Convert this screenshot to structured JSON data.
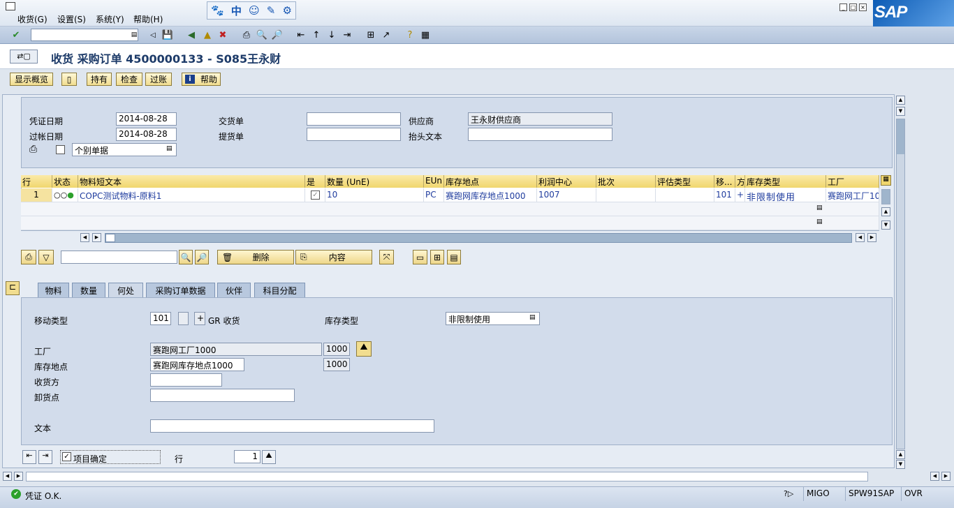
{
  "menu": [
    "收货(G)",
    "设置(S)",
    "系统(Y)",
    "帮助(H)"
  ],
  "sys_icons": [
    "paw-icon",
    "中",
    "smile-icon",
    "pen-icon",
    "gear-icon"
  ],
  "sap_logo": "SAP",
  "title": "收货 采购订单 4500000133 - S085王永财",
  "app_buttons": [
    "显示概览",
    "持有",
    "检查",
    "过账",
    "帮助"
  ],
  "header": {
    "doc_date_label": "凭证日期",
    "doc_date": "2014-08-28",
    "post_date_label": "过帐日期",
    "post_date": "2014-08-28",
    "slip_option": "个别单据",
    "delivery_note_label": "交货单",
    "delivery_note": "",
    "bill_of_lading_label": "提货单",
    "bill_of_lading": "",
    "vendor_label": "供应商",
    "vendor": "王永财供应商",
    "header_text_label": "抬头文本",
    "header_text": ""
  },
  "grid": {
    "columns": [
      "行",
      "状态",
      "物料短文本",
      "是",
      "数量 (UnE)",
      "EUn",
      "库存地点",
      "利润中心",
      "批次",
      "评估类型",
      "移...",
      "方",
      "库存类型",
      "工厂"
    ],
    "rows": [
      {
        "line": "1",
        "status": "COO",
        "material": "COPC测试物料-原料1",
        "ok": true,
        "qty": "10",
        "unit": "PC",
        "sloc": "赛跑网库存地点1000",
        "profit_center": "1007",
        "batch": "",
        "valuation": "",
        "mvt": "101",
        "dir": "+",
        "stock_type": "非限制使用",
        "plant": "赛跑网工厂10"
      }
    ]
  },
  "item_buttons": {
    "delete": "删除",
    "contents": "内容"
  },
  "tabs": [
    "物料",
    "数量",
    "何处",
    "采购订单数据",
    "伙伴",
    "科目分配"
  ],
  "active_tab": 2,
  "where": {
    "mvt_type_label": "移动类型",
    "mvt_type": "101",
    "mvt_sign": "+",
    "mvt_text": "GR 收货",
    "stock_type_label": "库存类型",
    "stock_type": "非限制使用",
    "plant_label": "工厂",
    "plant": "赛跑网工厂1000",
    "plant_code": "1000",
    "sloc_label": "库存地点",
    "sloc": "赛跑网库存地点1000",
    "sloc_code": "1000",
    "recipient_label": "收货方",
    "recipient": "",
    "unload_label": "卸货点",
    "unload": "",
    "text_label": "文本",
    "text": ""
  },
  "footer": {
    "item_ok_label": "项目确定",
    "item_ok": true,
    "line_label": "行",
    "line": "1"
  },
  "status": {
    "message": "凭证 O.K.",
    "tcode": "MIGO",
    "server": "SPW91SAP",
    "mode": "OVR"
  },
  "colors": {
    "header_bg": "#d2dceb",
    "grid_header": "#f0d66e",
    "button": "#f1dd8f",
    "sap_blue": "#0c5bb5",
    "ok_green": "#2ca02c"
  }
}
